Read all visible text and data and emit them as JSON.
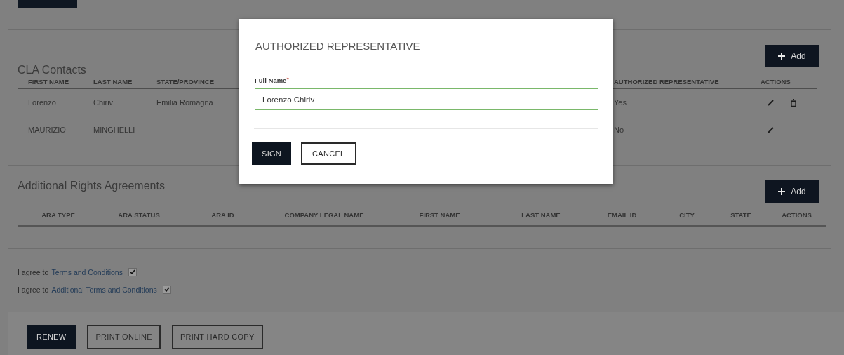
{
  "contacts": {
    "title": "CLA Contacts",
    "add_label": "Add",
    "columns": [
      "FIRST NAME",
      "LAST NAME",
      "STATE/PROVINCE",
      "AUTHORIZED REPRESENTATIVE",
      "ACTIONS"
    ],
    "rows": [
      {
        "first_name": "Lorenzo",
        "last_name": "Chiriv",
        "state_province": "Emilia Romagna",
        "authorized_representative": "Yes",
        "edit": true,
        "delete": true
      },
      {
        "first_name": "MAURIZIO",
        "last_name": "MINGHELLI",
        "authorized_representative": "No",
        "edit": true
      }
    ]
  },
  "agreements_table": {
    "title": "Additional Rights Agreements",
    "add_label": "Add",
    "columns": [
      "ARA TYPE",
      "ARA STATUS",
      "ARA ID",
      "COMPANY LEGAL NAME",
      "FIRST NAME",
      "LAST NAME",
      "EMAIL ID",
      "CITY",
      "STATE",
      "ACTIONS"
    ]
  },
  "consents": [
    {
      "prefix": "I agree to",
      "link": "Terms and Conditions",
      "checked": true
    },
    {
      "prefix": "I agree to",
      "link": "Additional Terms and Conditions",
      "checked": true
    }
  ],
  "footer_buttons": [
    {
      "label": "RENEW",
      "kind": "primary"
    },
    {
      "label": "PRINT ONLINE",
      "kind": "outline"
    },
    {
      "label": "PRINT HARD COPY",
      "kind": "outline"
    }
  ],
  "modal": {
    "title": "AUTHORIZED REPRESENTATIVE",
    "field_label": "Full Name",
    "required_mark": "*",
    "value": "Lorenzo Chiriv",
    "buttons": [
      {
        "label": "SIGN",
        "kind": "primary"
      },
      {
        "label": "CANCEL",
        "kind": "outline"
      }
    ]
  }
}
